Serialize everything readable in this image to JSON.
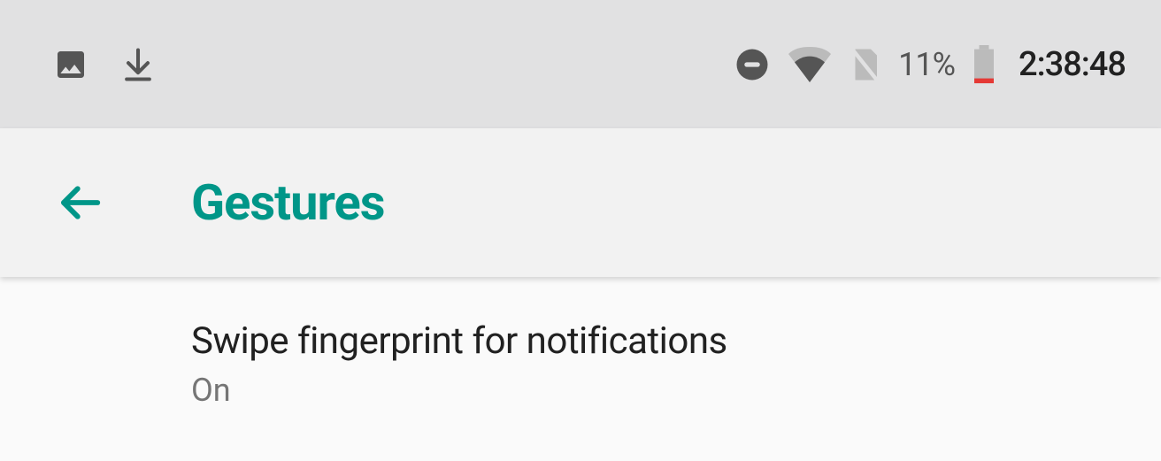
{
  "statusBar": {
    "batteryPct": "11%",
    "time": "2:38:48"
  },
  "appBar": {
    "title": "Gestures"
  },
  "content": {
    "items": [
      {
        "title": "Swipe fingerprint for notifications",
        "summary": "On"
      }
    ]
  }
}
